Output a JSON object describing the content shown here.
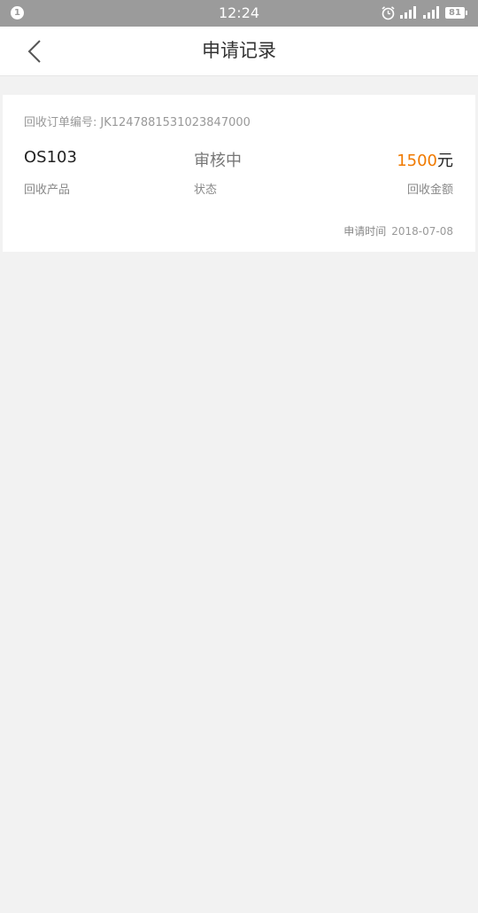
{
  "status_bar": {
    "notification_count": "1",
    "time": "12:24",
    "battery": "81",
    "icons": [
      "alarm-icon",
      "signal-icon",
      "signal-icon"
    ]
  },
  "header": {
    "title": "申请记录",
    "back_icon": "chevron-left-icon"
  },
  "record": {
    "order_label": "回收订单编号:",
    "order_number": "JK1247881531023847000",
    "product_name": "OS103",
    "product_label": "回收产品",
    "status_value": "审核中",
    "status_label": "状态",
    "amount_value": "1500",
    "amount_unit": "元",
    "amount_label": "回收金额",
    "time_label": "申请时间",
    "time_value": "2018-07-08"
  },
  "colors": {
    "accent": "#f07a00",
    "status_bar": "#9b9b9b",
    "background": "#f2f2f2"
  }
}
